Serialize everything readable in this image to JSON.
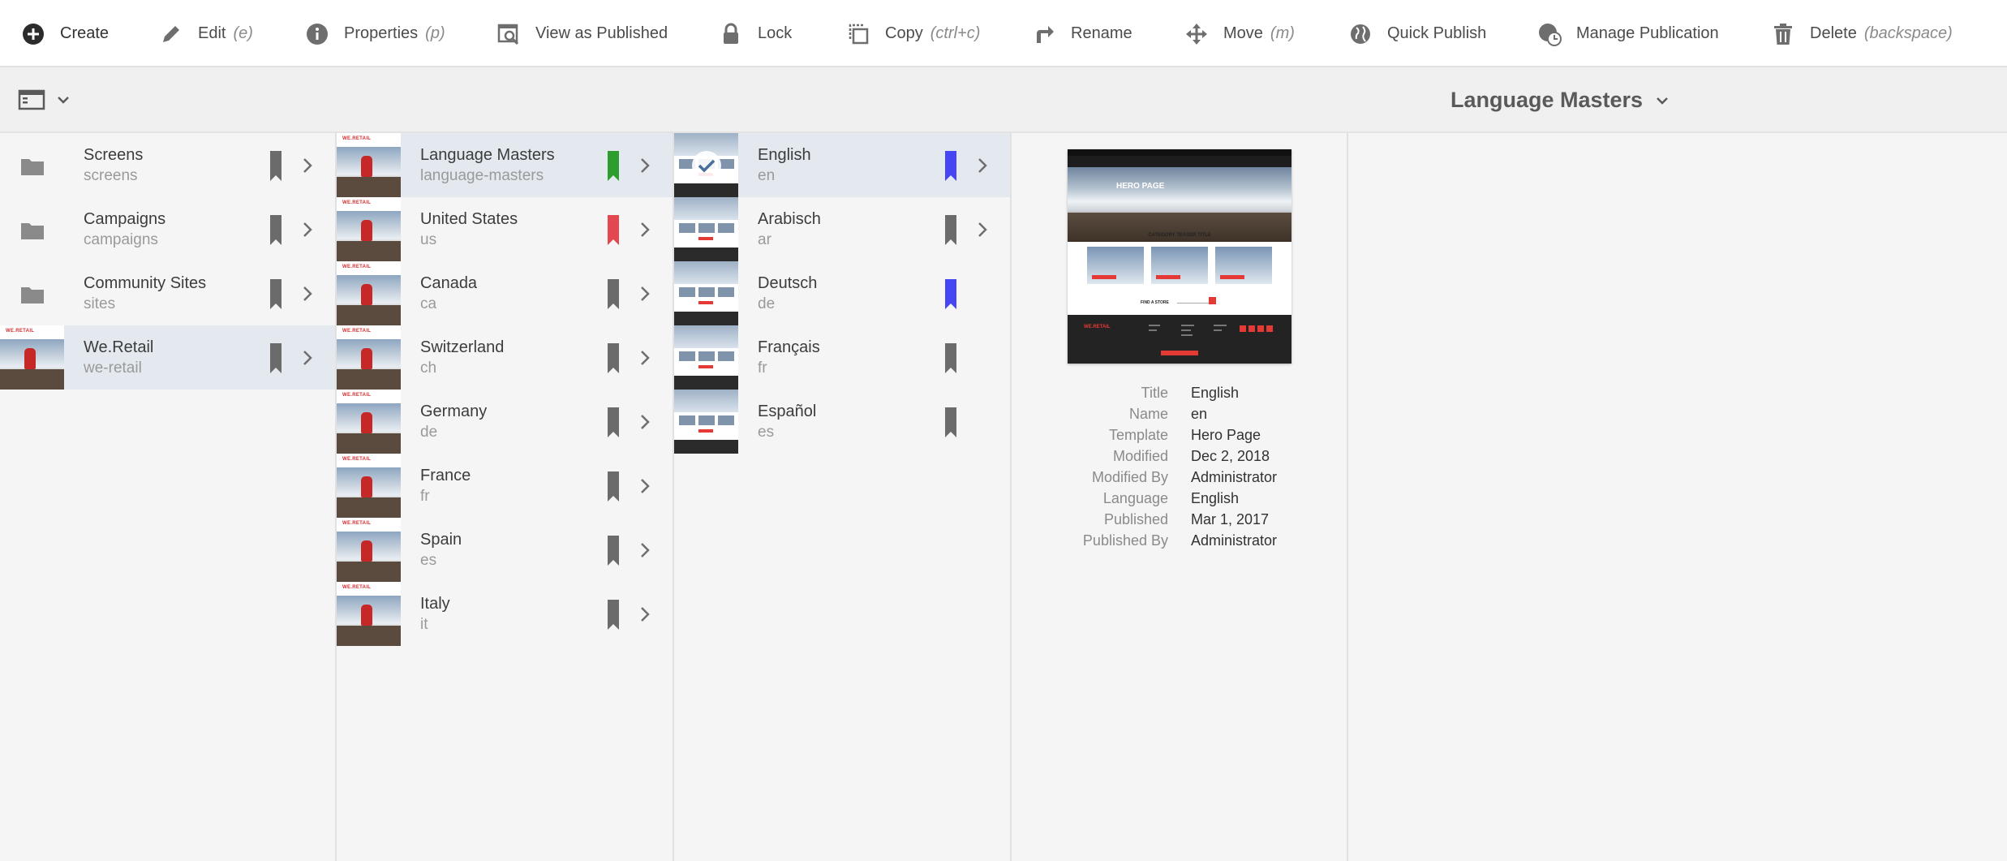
{
  "toolbar": {
    "create": "Create",
    "edit": "Edit",
    "edit_shortcut": "(e)",
    "properties": "Properties",
    "properties_shortcut": "(p)",
    "view_as_published": "View as Published",
    "lock": "Lock",
    "copy": "Copy",
    "copy_shortcut": "(ctrl+c)",
    "rename": "Rename",
    "move": "Move",
    "move_shortcut": "(m)",
    "quick_publish": "Quick Publish",
    "manage_publication": "Manage Publication",
    "delete": "Delete",
    "delete_shortcut": "(backspace)"
  },
  "header": {
    "current": "Language Masters"
  },
  "colors": {
    "flag_gray": "#6b6b6b",
    "flag_green": "#2d9d2d",
    "flag_red": "#e34850",
    "flag_blue": "#4646f5",
    "selected_row": "#e4e9ef"
  },
  "thumbnail_logo": "WE.RETAIL",
  "column1": [
    {
      "title": "Screens",
      "name": "screens",
      "icon": "folder-icon",
      "flag": "gray",
      "selected": false
    },
    {
      "title": "Campaigns",
      "name": "campaigns",
      "icon": "folder-icon",
      "flag": "gray",
      "selected": false
    },
    {
      "title": "Community Sites",
      "name": "sites",
      "icon": "folder-icon",
      "flag": "gray",
      "selected": false
    },
    {
      "title": "We.Retail",
      "name": "we-retail",
      "icon": "thumbnail",
      "flag": "gray",
      "selected": true
    }
  ],
  "column2": [
    {
      "title": "Language Masters",
      "name": "language-masters",
      "flag": "green",
      "selected": true
    },
    {
      "title": "United States",
      "name": "us",
      "flag": "red",
      "selected": false
    },
    {
      "title": "Canada",
      "name": "ca",
      "flag": "gray",
      "selected": false
    },
    {
      "title": "Switzerland",
      "name": "ch",
      "flag": "gray",
      "selected": false
    },
    {
      "title": "Germany",
      "name": "de",
      "flag": "gray",
      "selected": false
    },
    {
      "title": "France",
      "name": "fr",
      "flag": "gray",
      "selected": false
    },
    {
      "title": "Spain",
      "name": "es",
      "flag": "gray",
      "selected": false
    },
    {
      "title": "Italy",
      "name": "it",
      "flag": "gray",
      "selected": false
    }
  ],
  "column3": [
    {
      "title": "English",
      "name": "en",
      "flag": "blue",
      "selected": true,
      "checked": true,
      "has_children": true
    },
    {
      "title": "Arabisch",
      "name": "ar",
      "flag": "gray",
      "selected": false,
      "has_children": true
    },
    {
      "title": "Deutsch",
      "name": "de",
      "flag": "blue",
      "selected": false,
      "has_children": false
    },
    {
      "title": "Français",
      "name": "fr",
      "flag": "gray",
      "selected": false,
      "has_children": false
    },
    {
      "title": "Español",
      "name": "es",
      "flag": "gray",
      "selected": false,
      "has_children": false
    }
  ],
  "preview": {
    "hero_title": "HERO PAGE",
    "category_title": "CATEGORY TEASER TITLE",
    "find_store": "FIND A STORE",
    "footer_logo": "WE.RETAIL"
  },
  "details": [
    {
      "label": "Title",
      "value": "English"
    },
    {
      "label": "Name",
      "value": "en"
    },
    {
      "label": "Template",
      "value": "Hero Page"
    },
    {
      "label": "Modified",
      "value": "Dec 2, 2018"
    },
    {
      "label": "Modified By",
      "value": "Administrator"
    },
    {
      "label": "Language",
      "value": "English"
    },
    {
      "label": "Published",
      "value": "Mar 1, 2017"
    },
    {
      "label": "Published By",
      "value": "Administrator"
    }
  ]
}
